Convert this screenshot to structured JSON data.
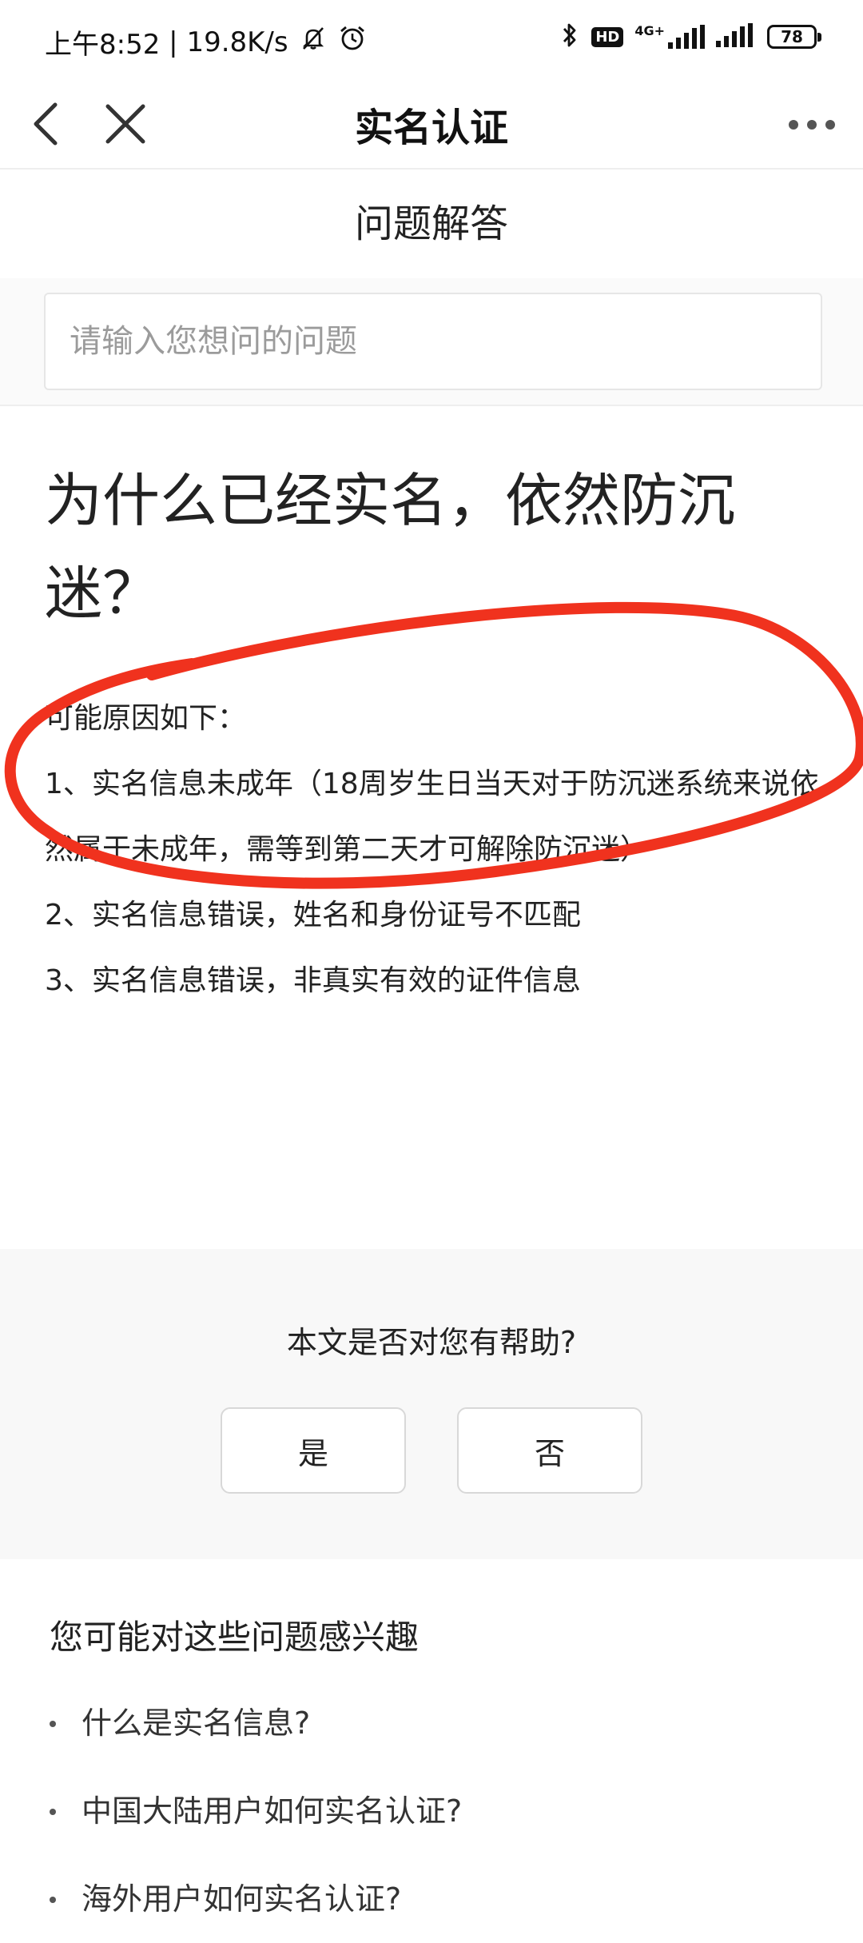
{
  "status_bar": {
    "time": "上午8:52",
    "speed": "19.8K/s",
    "hd": "HD",
    "network": "4G+",
    "battery": "78",
    "battery_level": 0.78,
    "icons": [
      "mute-bell-icon",
      "alarm-icon",
      "bluetooth-icon",
      "hd-icon",
      "signal-icon",
      "signal-icon",
      "battery-icon"
    ]
  },
  "nav": {
    "title": "实名认证",
    "icons": [
      "back-chevron-icon",
      "close-icon",
      "more-dots-icon"
    ]
  },
  "section": {
    "title": "问题解答"
  },
  "search": {
    "placeholder": "请输入您想问的问题",
    "value": ""
  },
  "article": {
    "title": "为什么已经实名，依然防沉迷？",
    "intro": "可能原因如下：",
    "reasons": [
      "1、实名信息未成年（18周岁生日当天对于防沉迷系统来说依然属于未成年，需等到第二天才可解除防沉迷）",
      "2、实名信息错误，姓名和身份证号不匹配",
      "3、实名信息错误，非真实有效的证件信息"
    ]
  },
  "feedback": {
    "question": "本文是否对您有帮助?",
    "yes_label": "是",
    "no_label": "否"
  },
  "related": {
    "title": "您可能对这些问题感兴趣",
    "items": [
      "什么是实名信息?",
      "中国大陆用户如何实名认证?",
      "海外用户如何实名认证?"
    ]
  },
  "colors": {
    "annotation": "#f0321e",
    "text": "#222222",
    "muted": "#9b9b9b",
    "feedback_bg": "#f8f8f8"
  }
}
